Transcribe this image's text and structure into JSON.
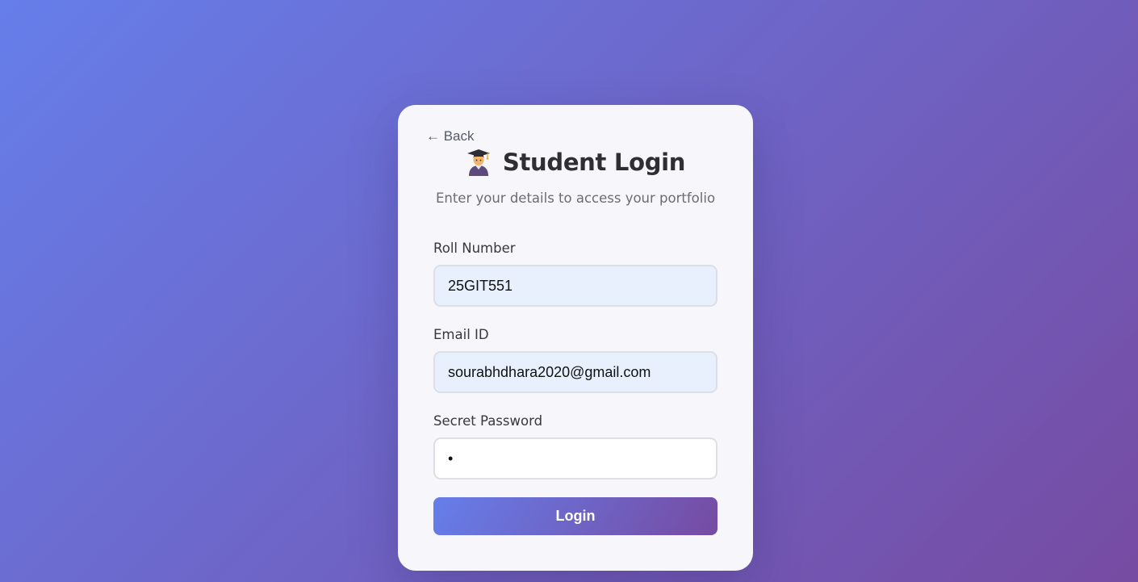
{
  "nav": {
    "back_label": "← Back"
  },
  "header": {
    "icon": "graduate-icon",
    "title": "Student Login",
    "subtitle": "Enter your details to access your portfolio"
  },
  "form": {
    "roll_number": {
      "label": "Roll Number",
      "value": "25GIT551"
    },
    "email": {
      "label": "Email ID",
      "value": "sourabhdhara2020@gmail.com"
    },
    "password": {
      "label": "Secret Password",
      "value": "•"
    },
    "submit_label": "Login"
  },
  "colors": {
    "gradient_start": "#667eea",
    "gradient_end": "#764ba2",
    "card_background": "#f7f6fb",
    "autofill_background": "#e8f0fe"
  }
}
